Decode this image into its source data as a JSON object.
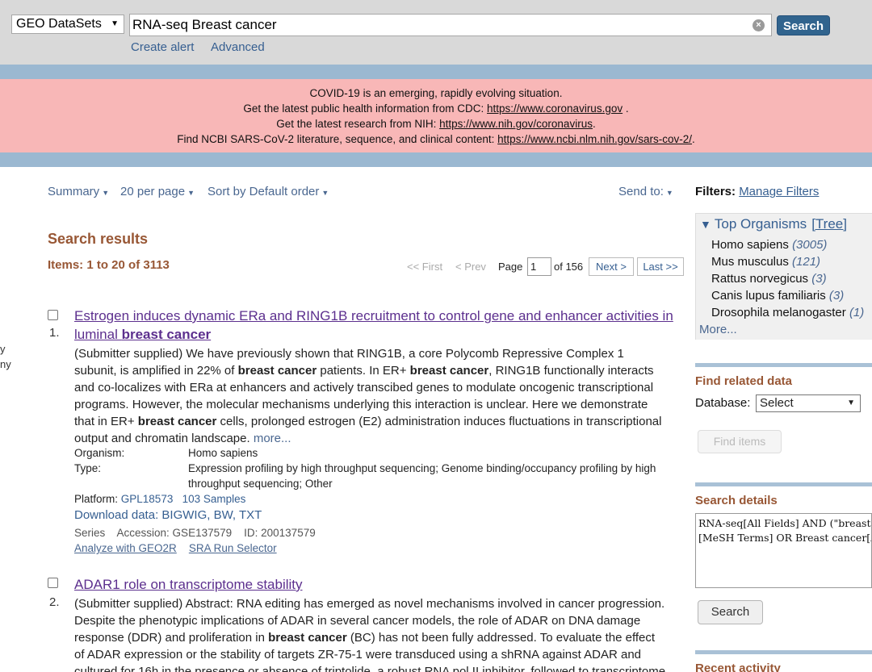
{
  "search": {
    "database": "GEO DataSets",
    "query": "RNA-seq Breast cancer",
    "button": "Search",
    "create_alert": "Create alert",
    "advanced": "Advanced"
  },
  "banner": {
    "line1": "COVID-19 is an emerging, rapidly evolving situation.",
    "line2_text": "Get the latest public health information from CDC: ",
    "line2_link": "https://www.coronavirus.gov",
    "line2_end": " .",
    "line3_text": "Get the latest research from NIH: ",
    "line3_link": "https://www.nih.gov/coronavirus",
    "line3_end": ".",
    "line4_text": "Find NCBI SARS-CoV-2 literature, sequence, and clinical content: ",
    "line4_link": "https://www.ncbi.nlm.nih.gov/sars-cov-2/",
    "line4_end": "."
  },
  "toolbar": {
    "format": "Summary",
    "per_page": "20 per page",
    "sort": "Sort by Default order",
    "send_to": "Send to:"
  },
  "results": {
    "heading": "Search results",
    "items": "Items: 1 to 20 of 3113",
    "pager": {
      "first": "<< First",
      "prev": "< Prev",
      "page_label": "Page",
      "page": "1",
      "of": "of 156",
      "next": "Next >",
      "last": "Last >>"
    },
    "r1": {
      "num": "1.",
      "title_a": "Estrogen induces dynamic ERa and RING1B recruitment to control gene and enhancer activities in",
      "title_b_prefix": "luminal ",
      "title_b_bold": "breast cancer",
      "d1": "(Submitter supplied) We have previously shown that RING1B, a core Polycomb Repressive Complex 1",
      "d2_a": "subunit, is amplified in 22% of ",
      "d2_b": "breast cancer",
      "d2_c": " patients. In ER+ ",
      "d2_d": "breast cancer",
      "d2_e": ", RING1B functionally interacts",
      "d3": "and co-localizes with ERa at enhancers and actively transcibed genes to modulate oncogenic transcriptional",
      "d4": "programs. However, the molecular mechanisms underlying this interaction is unclear. Here we demonstrate",
      "d5_a": "that in ER+ ",
      "d5_b": "breast cancer",
      "d5_c": " cells, prolonged estrogen (E2) administration induces fluctuations in transcriptional",
      "d6": "output and chromatin landscape. ",
      "more": "more...",
      "organism_label": "Organism:",
      "organism": "Homo sapiens",
      "type_label": "Type:",
      "type_1": "Expression profiling by high throughput sequencing; Genome binding/occupancy profiling by high",
      "type_2": "throughput sequencing; Other",
      "platform_label": "Platform:",
      "platform": "GPL18573",
      "samples": "103 Samples",
      "download_label": "Download data:",
      "download": "BIGWIG, BW, TXT",
      "series_label": "Series",
      "accession": "Accession: GSE137579",
      "id": "ID: 200137579",
      "geo2r": "Analyze with GEO2R",
      "sra": "SRA Run Selector"
    },
    "r2": {
      "num": "2.",
      "title": "ADAR1 role on transcriptome stability",
      "d1": "(Submitter supplied) Abstract: RNA editing has emerged as novel mechanisms involved in cancer progression.",
      "d2": "Despite the phenotypic implications of ADAR in several cancer models, the role of ADAR on DNA damage",
      "d3_a": "response (DDR) and proliferation in ",
      "d3_b": "breast cancer",
      "d3_c": " (BC) has not been fully addressed. To evaluate the effect",
      "d4": "of ADAR expression or the stability of targets ZR-75-1 were transduced using a shRNA against ADAR and",
      "d5": "cultured for 16h in the presence or absence of triptolide, a robust RNA pol II inhibitor, followed to transcriptome"
    }
  },
  "sidebar": {
    "filters_label": "Filters:",
    "manage_filters": "Manage Filters",
    "top_organisms": "Top Organisms",
    "tree": "[Tree]",
    "organisms": [
      {
        "name": "Homo sapiens",
        "count": "(3005)"
      },
      {
        "name": "Mus musculus",
        "count": "(121)"
      },
      {
        "name": "Rattus norvegicus",
        "count": "(3)"
      },
      {
        "name": "Canis lupus familiaris",
        "count": "(3)"
      },
      {
        "name": "Drosophila melanogaster",
        "count": "(1)"
      }
    ],
    "more": "More...",
    "find_related": "Find related data",
    "database_label": "Database:",
    "database_value": "Select",
    "find_items": "Find items",
    "search_details": "Search details",
    "query_details": "RNA-seq[All Fields] AND (\"breast neoplasms\"\n[MeSH Terms] OR Breast cancer[All Fields])",
    "details_search": "Search",
    "recent_activity": "Recent activity"
  },
  "edge": {
    "a": "y",
    "b": "ny"
  }
}
